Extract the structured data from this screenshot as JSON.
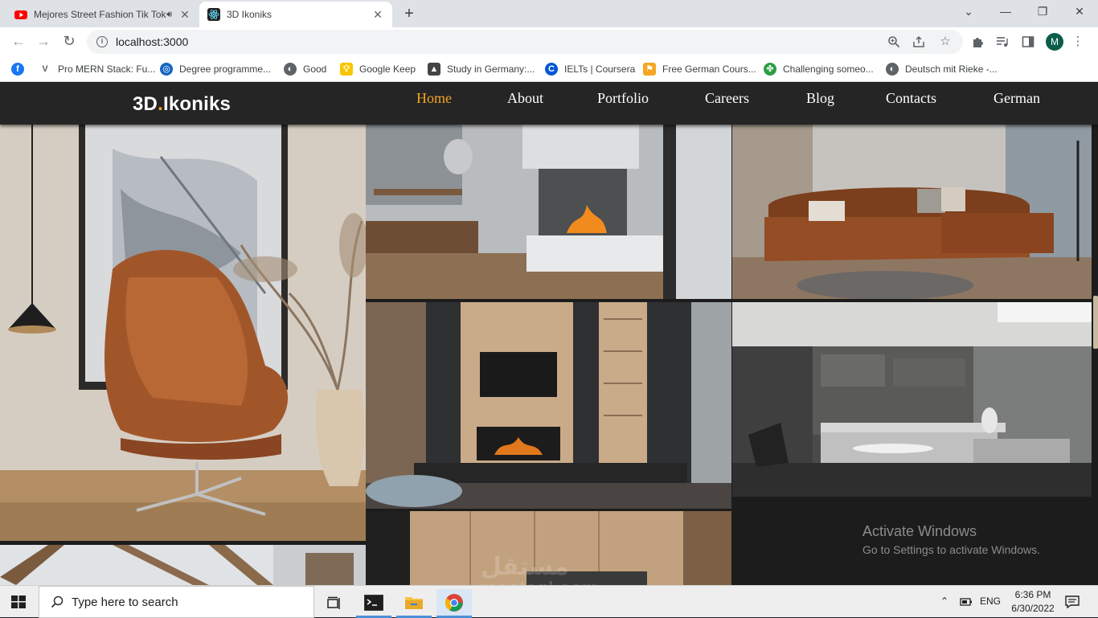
{
  "browser": {
    "tabs": [
      {
        "title": "Mejores Street Fashion Tik Tok",
        "favicon": "youtube-icon",
        "audio": true
      },
      {
        "title": "3D Ikoniks",
        "favicon": "react-icon",
        "active": true
      }
    ],
    "new_tab": "+",
    "window_controls": {
      "minimize": "—",
      "restore": "❐",
      "close": "✕",
      "tab_list": "⌄"
    },
    "address": "localhost:3000",
    "bookmarks": [
      {
        "label": "",
        "icon": "facebook-icon",
        "color": "#1877f2"
      },
      {
        "label": "Pro MERN Stack: Fu...",
        "icon": "v-icon",
        "color": "#5f6368"
      },
      {
        "label": "Degree programme...",
        "icon": "globe-badge-icon",
        "color": "#1565c0"
      },
      {
        "label": "Good",
        "icon": "globe-icon",
        "color": "#5f6368"
      },
      {
        "label": "Google Keep",
        "icon": "keep-icon",
        "color": "#f9c500"
      },
      {
        "label": "Study in Germany:...",
        "icon": "grad-cap-icon",
        "color": "#444444"
      },
      {
        "label": "IELTs | Coursera",
        "icon": "coursera-icon",
        "color": "#0056d2"
      },
      {
        "label": "Free German Cours...",
        "icon": "flag-icon",
        "color": "#f5a623"
      },
      {
        "label": "Challenging someo...",
        "icon": "clover-icon",
        "color": "#2e9e44"
      },
      {
        "label": "Deutsch mit Rieke -...",
        "icon": "globe-icon",
        "color": "#5f6368"
      }
    ],
    "profile_initial": "M"
  },
  "site": {
    "logo_main": "3D",
    "logo_dot": ".",
    "logo_rest": "Ikoniks",
    "accent_color": "#f5a623",
    "nav": [
      "Home",
      "About",
      "Portfolio",
      "Careers",
      "Blog",
      "Contacts",
      "German"
    ],
    "active_nav": "Home"
  },
  "os_overlay": {
    "activate_title": "Activate Windows",
    "activate_sub": "Go to Settings to activate Windows."
  },
  "watermark": {
    "line1": "مستقل",
    "line2": "mostaql.com"
  },
  "taskbar": {
    "search_placeholder": "Type here to search",
    "language": "ENG",
    "time": "6:36 PM",
    "date": "6/30/2022"
  }
}
